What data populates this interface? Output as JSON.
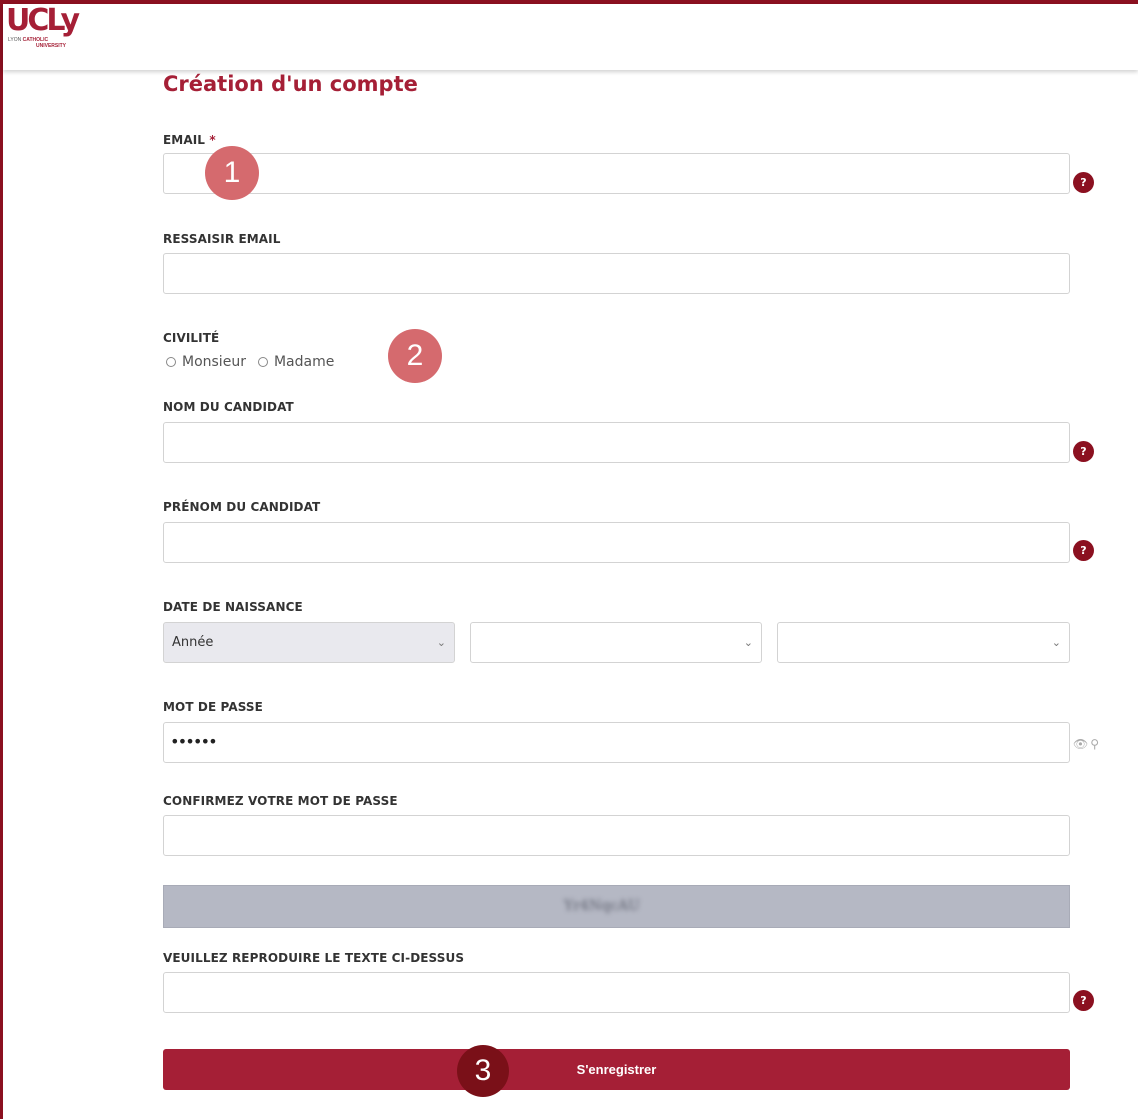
{
  "brand": {
    "logo_text": "UCLy",
    "logo_sub_prefix": "LYON",
    "logo_sub_highlight": "CATHOLIC",
    "logo_sub_line2": "UNIVERSITY",
    "accent_color": "#a51f36"
  },
  "form": {
    "title": "Création d'un compte",
    "email": {
      "label": "EMAIL",
      "required_mark": "*",
      "value": ""
    },
    "email_confirm": {
      "label": "RESSAISIR EMAIL",
      "value": ""
    },
    "civility": {
      "label": "CIVILITÉ",
      "options": [
        "Monsieur",
        "Madame"
      ]
    },
    "last_name": {
      "label": "NOM DU CANDIDAT",
      "value": ""
    },
    "first_name": {
      "label": "PRÉNOM DU CANDIDAT",
      "value": ""
    },
    "birth_date": {
      "label": "DATE DE NAISSANCE",
      "year_selected": "Année",
      "month_selected": "",
      "day_selected": ""
    },
    "password": {
      "label": "MOT DE PASSE",
      "value": "••••••"
    },
    "password_confirm": {
      "label": "CONFIRMEZ VOTRE MOT DE PASSE",
      "value": ""
    },
    "captcha": {
      "label": "VEUILLEZ REPRODUIRE LE TEXTE CI-DESSUS",
      "image_text": "Yr4NqcAU",
      "value": ""
    },
    "submit_label": "S'enregistrer",
    "help_symbol": "?"
  },
  "annotations": {
    "step1": "1",
    "step2": "2",
    "step3": "3"
  },
  "icons": {
    "help": "question-circle-icon",
    "eye": "eye-icon",
    "key": "key-icon",
    "chevron": "chevron-down-icon"
  }
}
